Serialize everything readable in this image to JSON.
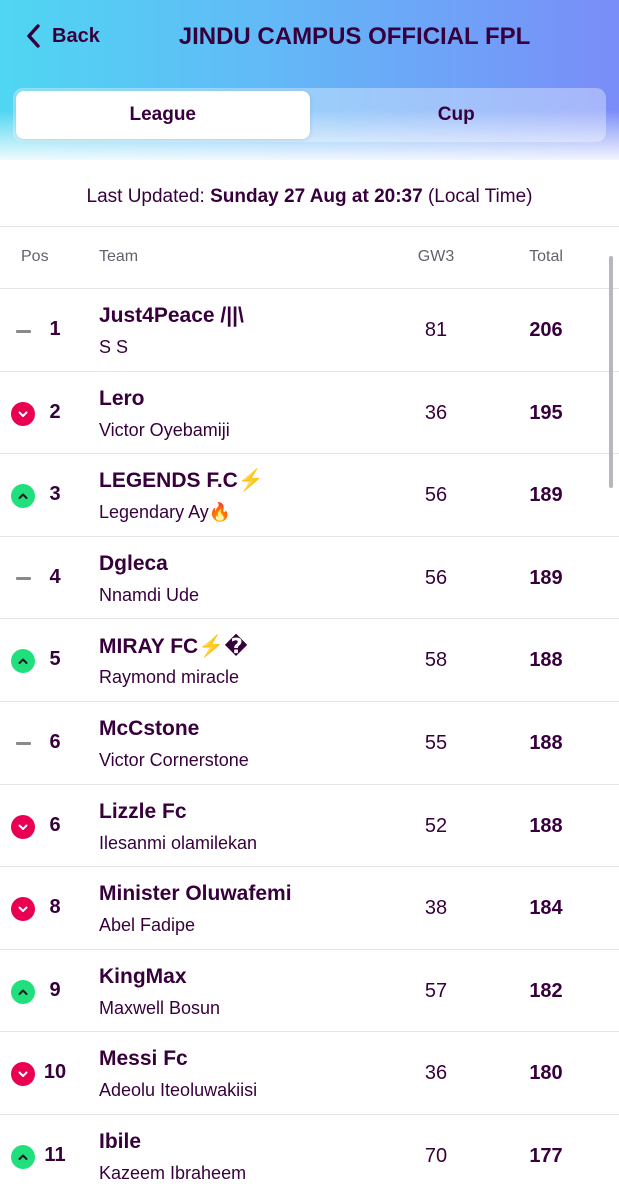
{
  "header": {
    "back_label": "Back",
    "title": "JINDU CAMPUS OFFICIAL FPL"
  },
  "tabs": [
    {
      "label": "League",
      "active": true
    },
    {
      "label": "Cup",
      "active": false
    }
  ],
  "updated": {
    "prefix": "Last Updated:",
    "datetime": "Sunday 27 Aug at 20:37",
    "suffix": "(Local Time)"
  },
  "columns": {
    "pos": "Pos",
    "team": "Team",
    "gw": "GW3",
    "total": "Total"
  },
  "colors": {
    "accent": "#37003c",
    "up": "#20e07e",
    "down": "#e90052",
    "same": "#8a8a8a"
  },
  "rows": [
    {
      "movement": "same",
      "pos": "1",
      "team": "Just4Peace /||\\",
      "manager": "S S",
      "gw": "81",
      "total": "206"
    },
    {
      "movement": "down",
      "pos": "2",
      "team": "Lero",
      "manager": "Victor Oyebamiji",
      "gw": "36",
      "total": "195"
    },
    {
      "movement": "up",
      "pos": "3",
      "team": "LEGENDS F.C⚡️",
      "manager": "Legendary Ay🔥",
      "gw": "56",
      "total": "189"
    },
    {
      "movement": "same",
      "pos": "4",
      "team": "Dgleca",
      "manager": "Nnamdi Ude",
      "gw": "56",
      "total": "189"
    },
    {
      "movement": "up",
      "pos": "5",
      "team": "MIRAY FC⚡️�",
      "manager": "Raymond miracle",
      "gw": "58",
      "total": "188"
    },
    {
      "movement": "same",
      "pos": "6",
      "team": "McCstone",
      "manager": "Victor Cornerstone",
      "gw": "55",
      "total": "188"
    },
    {
      "movement": "down",
      "pos": "6",
      "team": "Lizzle Fc",
      "manager": "Ilesanmi olamilekan",
      "gw": "52",
      "total": "188"
    },
    {
      "movement": "down",
      "pos": "8",
      "team": "Minister Oluwafemi",
      "manager": "Abel Fadipe",
      "gw": "38",
      "total": "184"
    },
    {
      "movement": "up",
      "pos": "9",
      "team": "KingMax",
      "manager": "Maxwell Bosun",
      "gw": "57",
      "total": "182"
    },
    {
      "movement": "down",
      "pos": "10",
      "team": "Messi Fc",
      "manager": "Adeolu Iteoluwakiisi",
      "gw": "36",
      "total": "180"
    },
    {
      "movement": "up",
      "pos": "11",
      "team": "Ibile",
      "manager": "Kazeem Ibraheem",
      "gw": "70",
      "total": "177"
    }
  ]
}
